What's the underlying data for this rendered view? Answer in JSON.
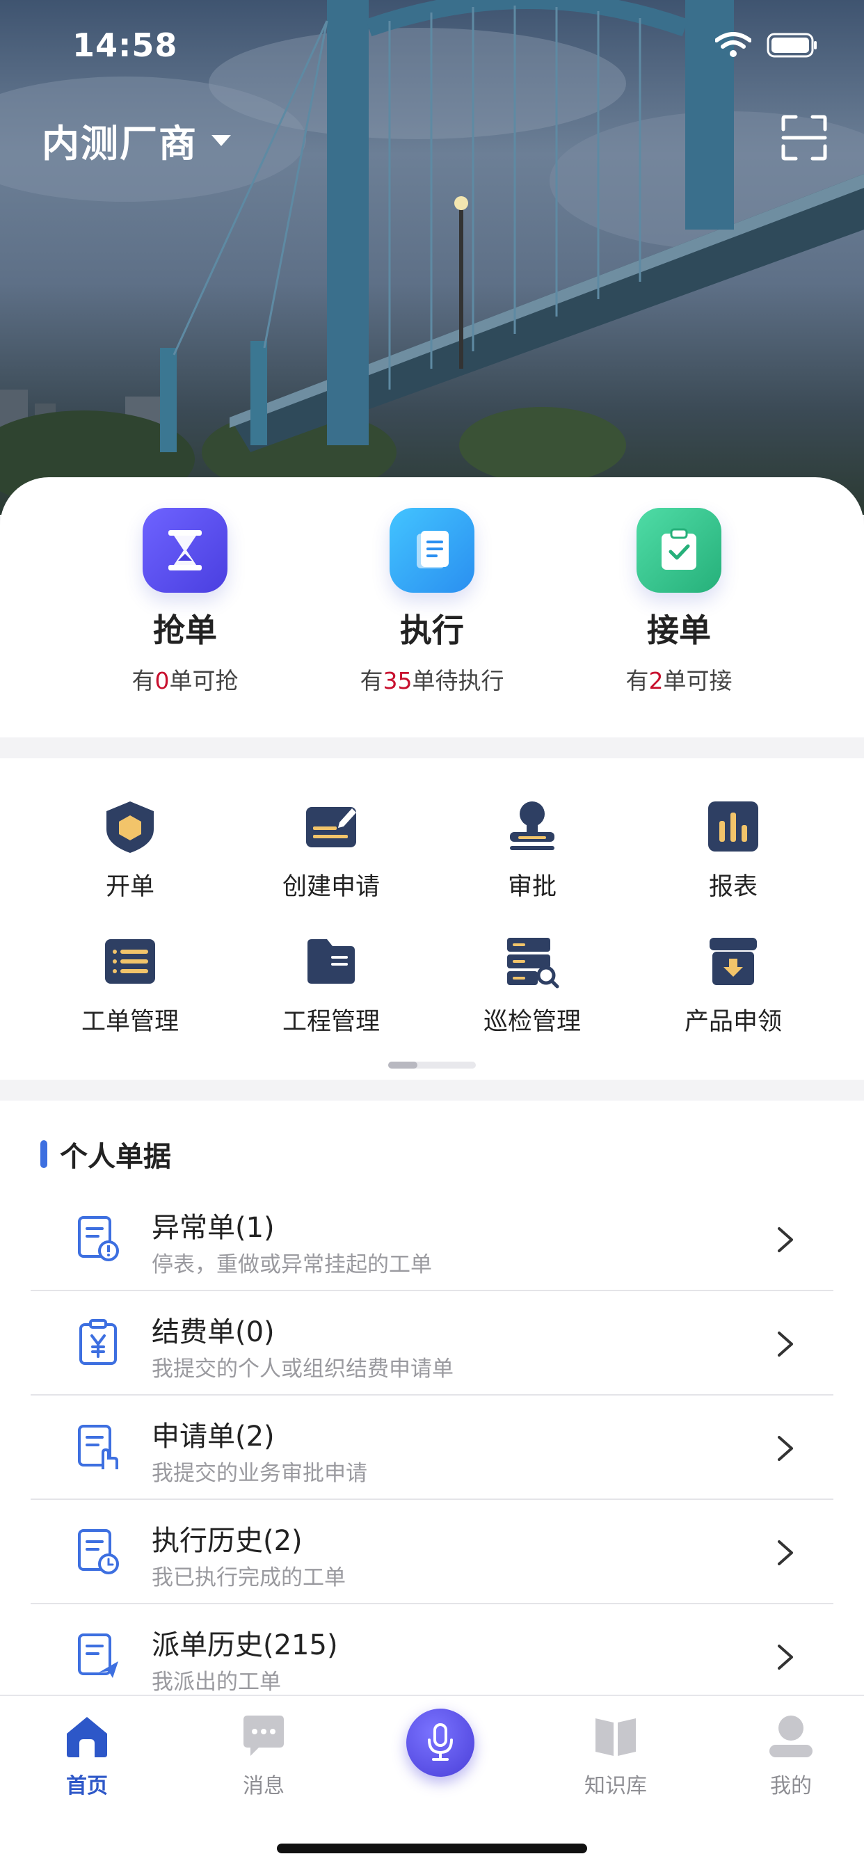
{
  "status_bar": {
    "time": "14:58"
  },
  "header": {
    "vendor": "内测厂商",
    "vendor_icon": "caret-down-icon",
    "scan_icon": "scan-icon"
  },
  "quick_actions": [
    {
      "title": "抢单",
      "prefix": "有",
      "count": "0",
      "suffix": "单可抢",
      "icon": "hourglass-icon",
      "color": "#5a4ff0"
    },
    {
      "title": "执行",
      "prefix": "有",
      "count": "35",
      "suffix": "单待执行",
      "icon": "clipboard-icon",
      "color": "#2fa6f5"
    },
    {
      "title": "接单",
      "prefix": "有",
      "count": "2",
      "suffix": "单可接",
      "icon": "clipboard-check-icon",
      "color": "#34c38f"
    }
  ],
  "grid": [
    {
      "label": "开单",
      "icon": "shield-icon"
    },
    {
      "label": "创建申请",
      "icon": "edit-card-icon"
    },
    {
      "label": "审批",
      "icon": "stamp-icon"
    },
    {
      "label": "报表",
      "icon": "bar-chart-icon"
    },
    {
      "label": "工单管理",
      "icon": "list-icon"
    },
    {
      "label": "工程管理",
      "icon": "folder-icon"
    },
    {
      "label": "巡检管理",
      "icon": "server-search-icon"
    },
    {
      "label": "产品申领",
      "icon": "archive-box-icon"
    }
  ],
  "personal_docs": {
    "title": "个人单据",
    "items": [
      {
        "title": "异常单(1)",
        "subtitle": "停表，重做或异常挂起的工单",
        "icon": "doc-alert-icon"
      },
      {
        "title": "结费单(0)",
        "subtitle": "我提交的个人或组织结费申请单",
        "icon": "doc-yen-icon"
      },
      {
        "title": "申请单(2)",
        "subtitle": "我提交的业务审批申请",
        "icon": "doc-hand-icon"
      },
      {
        "title": "执行历史(2)",
        "subtitle": "我已执行完成的工单",
        "icon": "doc-clock-icon"
      },
      {
        "title": "派单历史(215)",
        "subtitle": "我派出的工单",
        "icon": "doc-send-icon"
      }
    ]
  },
  "tabbar": {
    "tabs": [
      {
        "label": "首页",
        "icon": "home-icon",
        "active": true
      },
      {
        "label": "消息",
        "icon": "message-icon",
        "active": false
      },
      {
        "label": "知识库",
        "icon": "book-icon",
        "active": false
      },
      {
        "label": "我的",
        "icon": "user-icon",
        "active": false
      }
    ],
    "mic_icon": "microphone-icon"
  },
  "colors": {
    "accent": "#2d57c8",
    "count_red": "#c8102e",
    "icon_navy": "#2e3f63",
    "icon_gold": "#f2c46a"
  }
}
